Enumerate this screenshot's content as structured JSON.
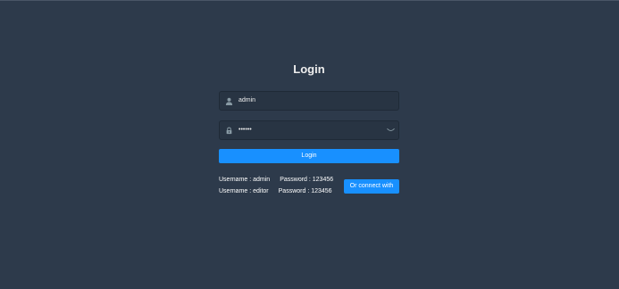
{
  "page": {
    "title": "Login"
  },
  "form": {
    "username_value": "admin",
    "password_mask": "••••••",
    "login_label": "Login"
  },
  "tips": [
    {
      "username": "Username : admin",
      "password": "Password : 123456"
    },
    {
      "username": "Username : editor",
      "password": "Password : 123456"
    }
  ],
  "connect_label": "Or connect with",
  "icons": {
    "username": "user-icon",
    "password": "lock-icon",
    "show_password": "eye-icon"
  },
  "colors": {
    "background": "#2d3a4b",
    "input_background": "#283443",
    "primary": "#1890ff",
    "text": "#eeeeee"
  }
}
